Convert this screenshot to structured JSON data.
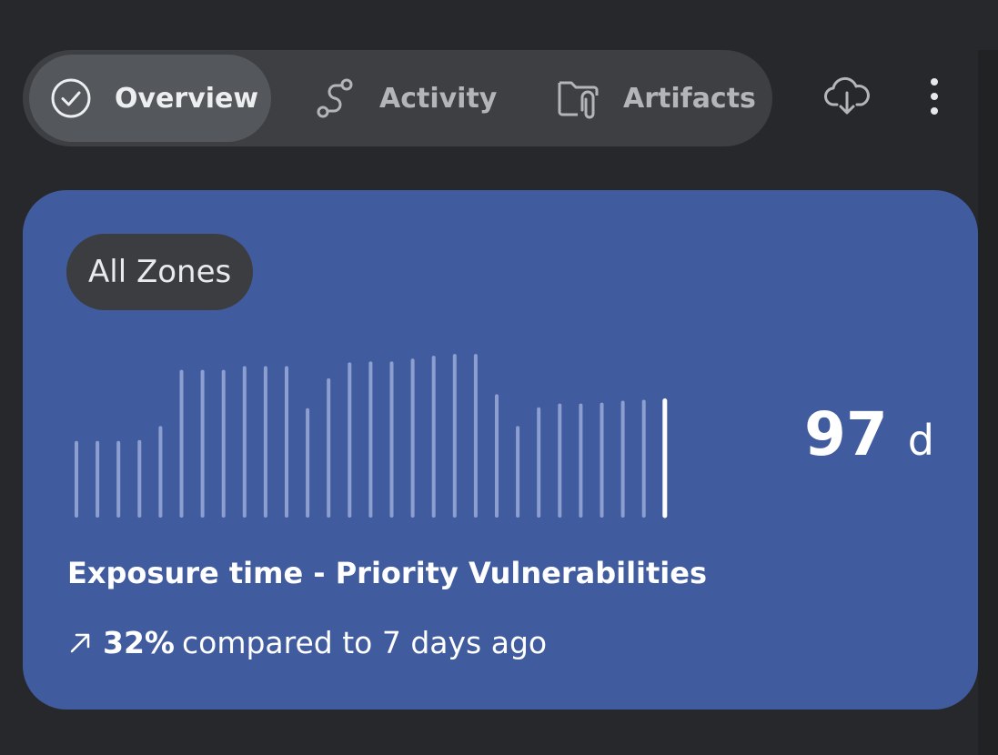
{
  "tabs": [
    {
      "label": "Overview",
      "icon": "check-circle-icon",
      "active": true
    },
    {
      "label": "Activity",
      "icon": "route-icon",
      "active": false
    },
    {
      "label": "Artifacts",
      "icon": "folder-attachment-icon",
      "active": false
    }
  ],
  "actions": {
    "download_icon": "cloud-download-icon",
    "more_icon": "more-vertical-icon"
  },
  "card": {
    "zone_chip": "All Zones",
    "value": "97",
    "unit": "d",
    "title": "Exposure time - Priority Vulnerabilities",
    "trend": {
      "direction_icon": "arrow-up-right-icon",
      "percent": "32%",
      "text": "compared to 7 days ago"
    },
    "colors": {
      "card_bg": "#405b9e",
      "bar": "#8c9fd0",
      "bar_current": "#ffffff"
    }
  },
  "chart_data": {
    "type": "bar",
    "values": [
      78,
      78,
      78,
      79,
      94,
      154,
      154,
      154,
      158,
      158,
      158,
      113,
      145,
      162,
      163,
      163,
      166,
      169,
      171,
      171,
      128,
      94,
      114,
      118,
      118,
      119,
      121,
      122,
      123
    ],
    "highlight_last": true
  }
}
